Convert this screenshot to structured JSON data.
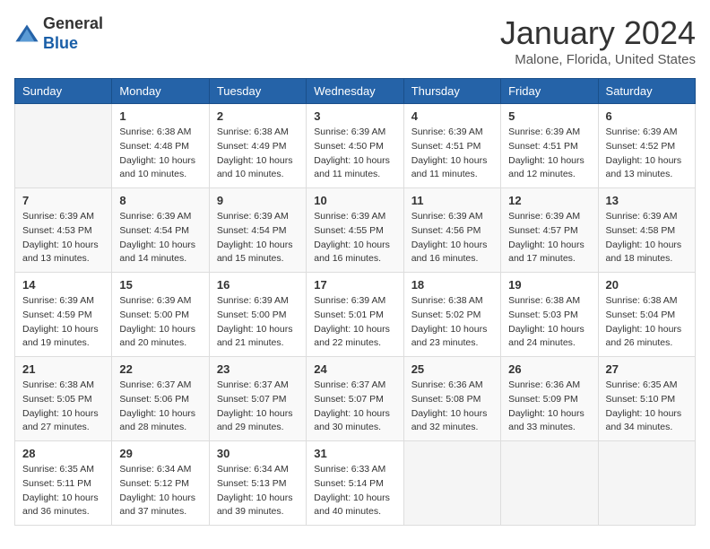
{
  "logo": {
    "general": "General",
    "blue": "Blue"
  },
  "header": {
    "title": "January 2024",
    "subtitle": "Malone, Florida, United States"
  },
  "columns": [
    "Sunday",
    "Monday",
    "Tuesday",
    "Wednesday",
    "Thursday",
    "Friday",
    "Saturday"
  ],
  "weeks": [
    [
      {
        "day": "",
        "sunrise": "",
        "sunset": "",
        "daylight": ""
      },
      {
        "day": "1",
        "sunrise": "Sunrise: 6:38 AM",
        "sunset": "Sunset: 4:48 PM",
        "daylight": "Daylight: 10 hours and 10 minutes."
      },
      {
        "day": "2",
        "sunrise": "Sunrise: 6:38 AM",
        "sunset": "Sunset: 4:49 PM",
        "daylight": "Daylight: 10 hours and 10 minutes."
      },
      {
        "day": "3",
        "sunrise": "Sunrise: 6:39 AM",
        "sunset": "Sunset: 4:50 PM",
        "daylight": "Daylight: 10 hours and 11 minutes."
      },
      {
        "day": "4",
        "sunrise": "Sunrise: 6:39 AM",
        "sunset": "Sunset: 4:51 PM",
        "daylight": "Daylight: 10 hours and 11 minutes."
      },
      {
        "day": "5",
        "sunrise": "Sunrise: 6:39 AM",
        "sunset": "Sunset: 4:51 PM",
        "daylight": "Daylight: 10 hours and 12 minutes."
      },
      {
        "day": "6",
        "sunrise": "Sunrise: 6:39 AM",
        "sunset": "Sunset: 4:52 PM",
        "daylight": "Daylight: 10 hours and 13 minutes."
      }
    ],
    [
      {
        "day": "7",
        "sunrise": "Sunrise: 6:39 AM",
        "sunset": "Sunset: 4:53 PM",
        "daylight": "Daylight: 10 hours and 13 minutes."
      },
      {
        "day": "8",
        "sunrise": "Sunrise: 6:39 AM",
        "sunset": "Sunset: 4:54 PM",
        "daylight": "Daylight: 10 hours and 14 minutes."
      },
      {
        "day": "9",
        "sunrise": "Sunrise: 6:39 AM",
        "sunset": "Sunset: 4:54 PM",
        "daylight": "Daylight: 10 hours and 15 minutes."
      },
      {
        "day": "10",
        "sunrise": "Sunrise: 6:39 AM",
        "sunset": "Sunset: 4:55 PM",
        "daylight": "Daylight: 10 hours and 16 minutes."
      },
      {
        "day": "11",
        "sunrise": "Sunrise: 6:39 AM",
        "sunset": "Sunset: 4:56 PM",
        "daylight": "Daylight: 10 hours and 16 minutes."
      },
      {
        "day": "12",
        "sunrise": "Sunrise: 6:39 AM",
        "sunset": "Sunset: 4:57 PM",
        "daylight": "Daylight: 10 hours and 17 minutes."
      },
      {
        "day": "13",
        "sunrise": "Sunrise: 6:39 AM",
        "sunset": "Sunset: 4:58 PM",
        "daylight": "Daylight: 10 hours and 18 minutes."
      }
    ],
    [
      {
        "day": "14",
        "sunrise": "Sunrise: 6:39 AM",
        "sunset": "Sunset: 4:59 PM",
        "daylight": "Daylight: 10 hours and 19 minutes."
      },
      {
        "day": "15",
        "sunrise": "Sunrise: 6:39 AM",
        "sunset": "Sunset: 5:00 PM",
        "daylight": "Daylight: 10 hours and 20 minutes."
      },
      {
        "day": "16",
        "sunrise": "Sunrise: 6:39 AM",
        "sunset": "Sunset: 5:00 PM",
        "daylight": "Daylight: 10 hours and 21 minutes."
      },
      {
        "day": "17",
        "sunrise": "Sunrise: 6:39 AM",
        "sunset": "Sunset: 5:01 PM",
        "daylight": "Daylight: 10 hours and 22 minutes."
      },
      {
        "day": "18",
        "sunrise": "Sunrise: 6:38 AM",
        "sunset": "Sunset: 5:02 PM",
        "daylight": "Daylight: 10 hours and 23 minutes."
      },
      {
        "day": "19",
        "sunrise": "Sunrise: 6:38 AM",
        "sunset": "Sunset: 5:03 PM",
        "daylight": "Daylight: 10 hours and 24 minutes."
      },
      {
        "day": "20",
        "sunrise": "Sunrise: 6:38 AM",
        "sunset": "Sunset: 5:04 PM",
        "daylight": "Daylight: 10 hours and 26 minutes."
      }
    ],
    [
      {
        "day": "21",
        "sunrise": "Sunrise: 6:38 AM",
        "sunset": "Sunset: 5:05 PM",
        "daylight": "Daylight: 10 hours and 27 minutes."
      },
      {
        "day": "22",
        "sunrise": "Sunrise: 6:37 AM",
        "sunset": "Sunset: 5:06 PM",
        "daylight": "Daylight: 10 hours and 28 minutes."
      },
      {
        "day": "23",
        "sunrise": "Sunrise: 6:37 AM",
        "sunset": "Sunset: 5:07 PM",
        "daylight": "Daylight: 10 hours and 29 minutes."
      },
      {
        "day": "24",
        "sunrise": "Sunrise: 6:37 AM",
        "sunset": "Sunset: 5:07 PM",
        "daylight": "Daylight: 10 hours and 30 minutes."
      },
      {
        "day": "25",
        "sunrise": "Sunrise: 6:36 AM",
        "sunset": "Sunset: 5:08 PM",
        "daylight": "Daylight: 10 hours and 32 minutes."
      },
      {
        "day": "26",
        "sunrise": "Sunrise: 6:36 AM",
        "sunset": "Sunset: 5:09 PM",
        "daylight": "Daylight: 10 hours and 33 minutes."
      },
      {
        "day": "27",
        "sunrise": "Sunrise: 6:35 AM",
        "sunset": "Sunset: 5:10 PM",
        "daylight": "Daylight: 10 hours and 34 minutes."
      }
    ],
    [
      {
        "day": "28",
        "sunrise": "Sunrise: 6:35 AM",
        "sunset": "Sunset: 5:11 PM",
        "daylight": "Daylight: 10 hours and 36 minutes."
      },
      {
        "day": "29",
        "sunrise": "Sunrise: 6:34 AM",
        "sunset": "Sunset: 5:12 PM",
        "daylight": "Daylight: 10 hours and 37 minutes."
      },
      {
        "day": "30",
        "sunrise": "Sunrise: 6:34 AM",
        "sunset": "Sunset: 5:13 PM",
        "daylight": "Daylight: 10 hours and 39 minutes."
      },
      {
        "day": "31",
        "sunrise": "Sunrise: 6:33 AM",
        "sunset": "Sunset: 5:14 PM",
        "daylight": "Daylight: 10 hours and 40 minutes."
      },
      {
        "day": "",
        "sunrise": "",
        "sunset": "",
        "daylight": ""
      },
      {
        "day": "",
        "sunrise": "",
        "sunset": "",
        "daylight": ""
      },
      {
        "day": "",
        "sunrise": "",
        "sunset": "",
        "daylight": ""
      }
    ]
  ]
}
